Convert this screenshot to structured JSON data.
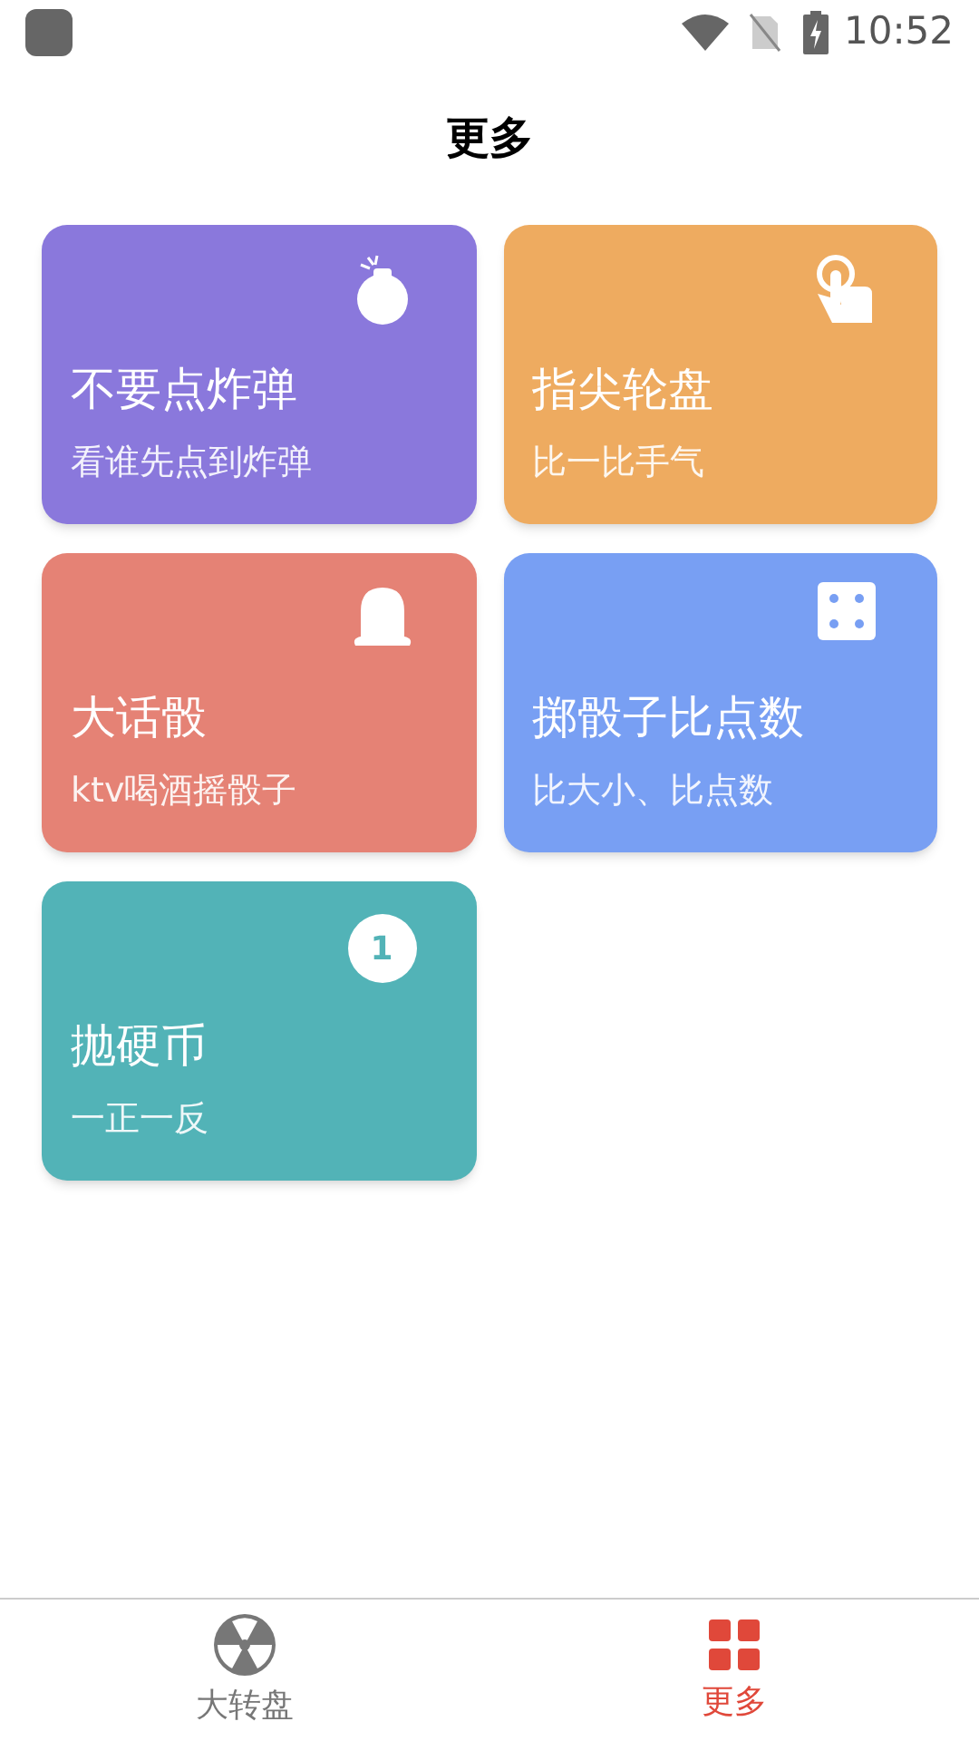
{
  "status_bar": {
    "time": "10:52"
  },
  "header": {
    "title": "更多"
  },
  "cards": [
    {
      "kind": "bomb",
      "title": "不要点炸弹",
      "subtitle": "看谁先点到炸弹",
      "color": "#8a78dc"
    },
    {
      "kind": "tap",
      "title": "指尖轮盘",
      "subtitle": "比一比手气",
      "color": "#eeab60"
    },
    {
      "kind": "cup",
      "title": "大话骰",
      "subtitle": "ktv喝酒摇骰子",
      "color": "#e58275"
    },
    {
      "kind": "dice",
      "title": "掷骰子比点数",
      "subtitle": "比大小、比点数",
      "color": "#789ff3"
    },
    {
      "kind": "coin",
      "title": "抛硬币",
      "subtitle": "一正一反",
      "color": "#52b3b7",
      "icon_text": "1"
    }
  ],
  "bottom_nav": [
    {
      "kind": "wheel",
      "label": "大转盘",
      "selected": false
    },
    {
      "kind": "grid",
      "label": "更多",
      "selected": true
    }
  ]
}
